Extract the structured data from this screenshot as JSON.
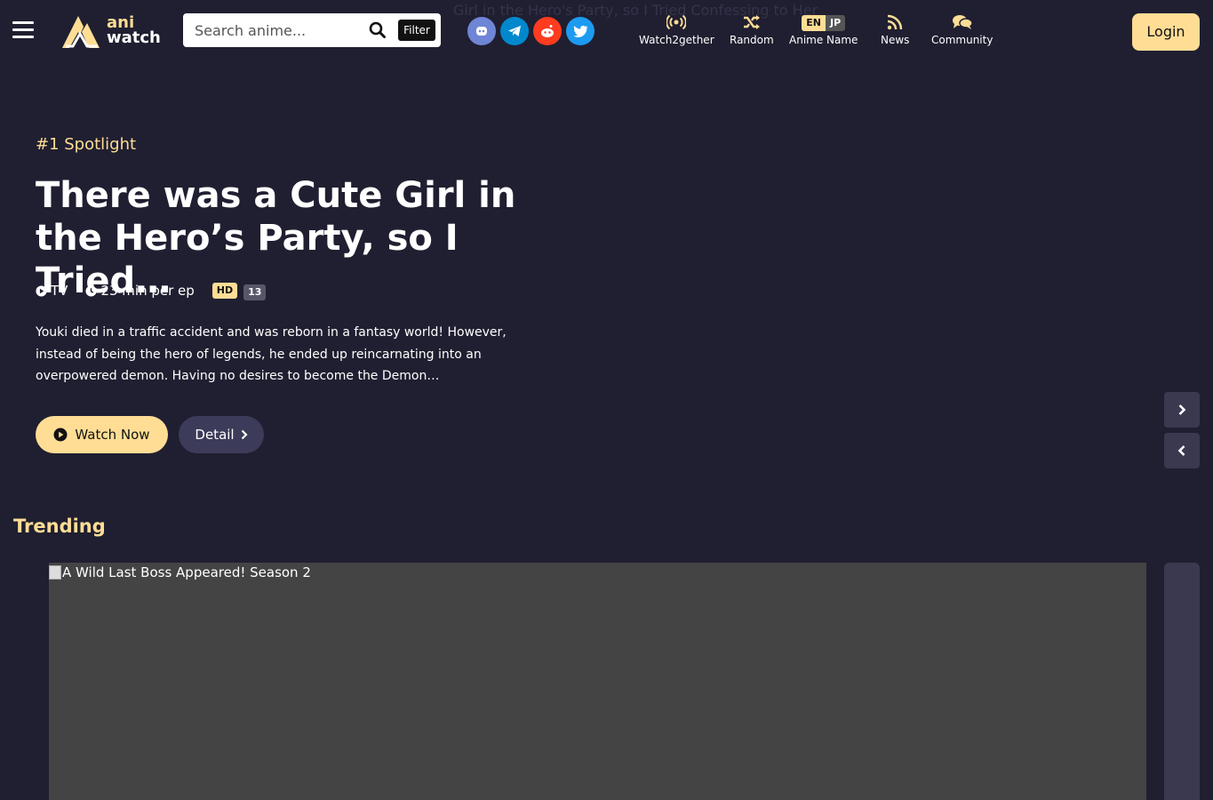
{
  "header": {
    "background_title": "Girl in the Hero's Party, so I Tried Confessing to Her",
    "logo": {
      "line1": "ani",
      "line2": "watch"
    },
    "search": {
      "placeholder": "Search anime...",
      "filter_label": "Filter"
    },
    "social": [
      "discord",
      "telegram",
      "reddit",
      "twitter"
    ],
    "nav": [
      {
        "label": "Watch2gether",
        "icon": "broadcast-icon"
      },
      {
        "label": "Random",
        "icon": "shuffle-icon"
      },
      {
        "label": "Anime Name",
        "icon": "language-toggle",
        "lang_en": "EN",
        "lang_jp": "JP"
      },
      {
        "label": "News",
        "icon": "rss-icon"
      },
      {
        "label": "Community",
        "icon": "comments-icon"
      }
    ],
    "login_label": "Login"
  },
  "spotlight": {
    "rank_label": "#1 Spotlight",
    "title": "There was a Cute Girl in the Hero’s Party, so I Tried…",
    "type": "TV",
    "duration": "23 min per ep",
    "quality": "HD",
    "episodes": "13",
    "description": "Youki died in a traffic accident and was reborn in a fantasy world! However, instead of being the hero of legends, he ended up reincarnating into an overpowered demon. Having no desires to become the Demon…",
    "watch_label": "Watch Now",
    "detail_label": "Detail"
  },
  "trending": {
    "title": "Trending",
    "items": [
      {
        "alt": "A Wild Last Boss Appeared! Season 2"
      }
    ]
  },
  "colors": {
    "accent": "#ffdd95",
    "background": "#201f31"
  }
}
